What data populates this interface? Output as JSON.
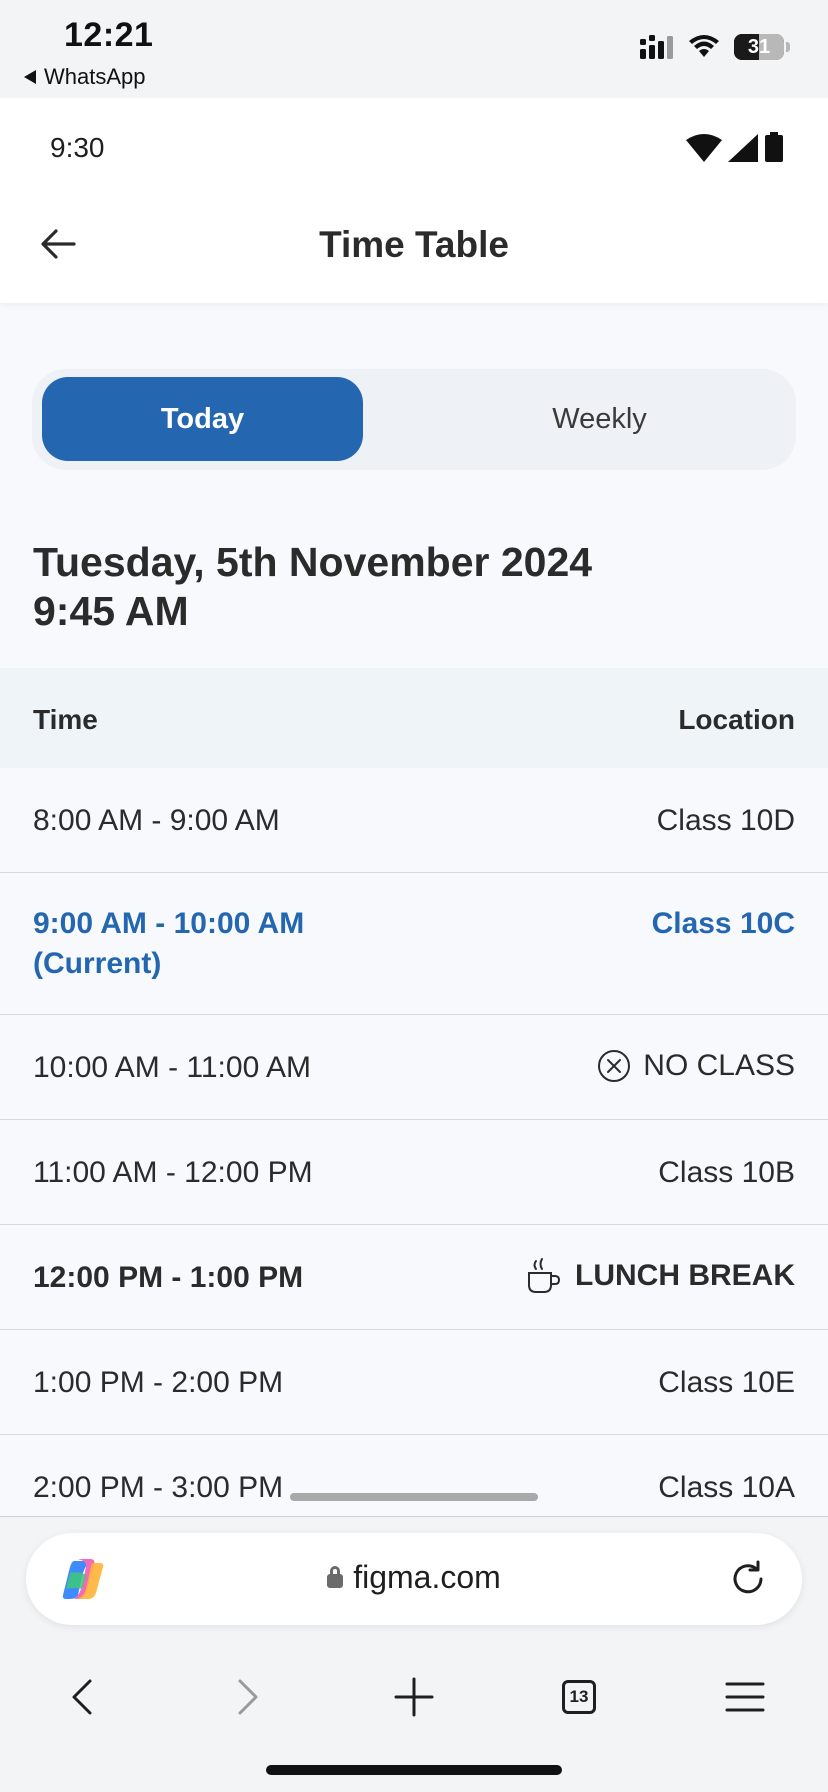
{
  "ios_status": {
    "time": "12:21",
    "back_app": "WhatsApp",
    "battery": "31"
  },
  "app_status": {
    "time": "9:30"
  },
  "header": {
    "title": "Time Table"
  },
  "tabs": {
    "today": "Today",
    "weekly": "Weekly",
    "selected": "Today"
  },
  "date": {
    "line1": "Tuesday, 5th November 2024",
    "line2": "9:45 AM"
  },
  "table": {
    "headers": {
      "time": "Time",
      "location": "Location"
    },
    "rows": [
      {
        "time": "8:00 AM - 9:00 AM",
        "location": "Class 10D"
      },
      {
        "time": "9:00 AM - 10:00 AM",
        "time_note": "(Current)",
        "location": "Class 10C"
      },
      {
        "time": "10:00 AM - 11:00 AM",
        "location": "NO CLASS",
        "icon": "circle-x-icon"
      },
      {
        "time": "11:00 AM - 12:00 PM",
        "location": "Class 10B"
      },
      {
        "time": "12:00 PM - 1:00 PM",
        "location": "LUNCH BREAK",
        "icon": "coffee-cup-icon"
      },
      {
        "time": "1:00 PM - 2:00 PM",
        "location": "Class 10E"
      },
      {
        "time": "2:00 PM - 3:00 PM",
        "location": "Class 10A"
      }
    ]
  },
  "colors": {
    "accent": "#2467b0",
    "table_header_bg": "#eff4f9",
    "page_bg": "#f7f9fc"
  },
  "browser": {
    "url": "figma.com",
    "tab_count": "13"
  }
}
